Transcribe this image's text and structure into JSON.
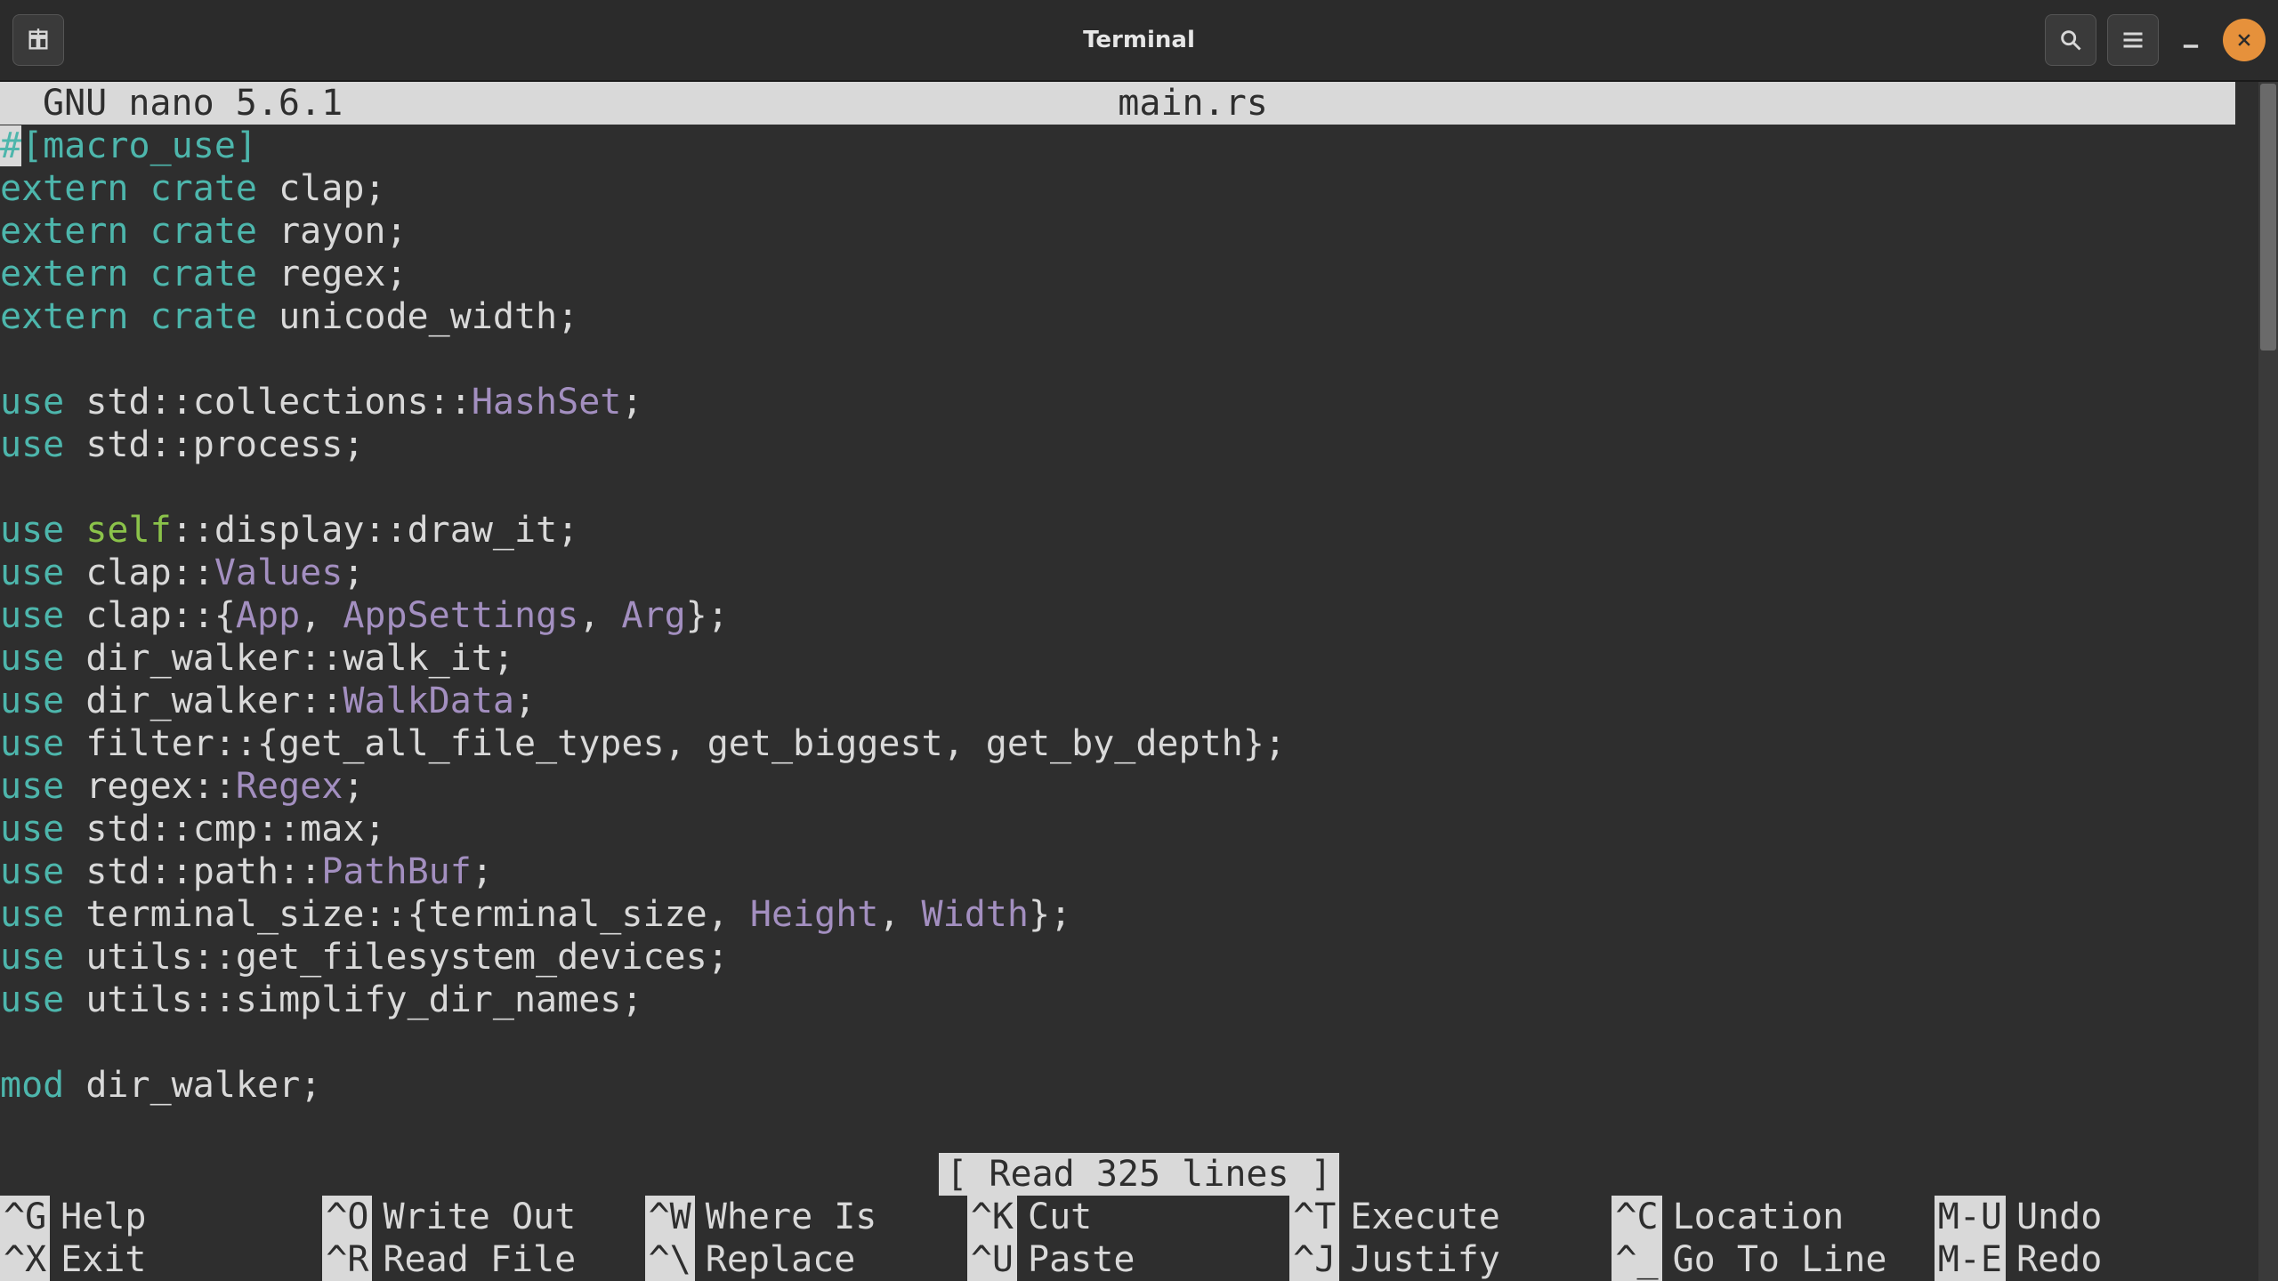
{
  "titlebar": {
    "title": "Terminal"
  },
  "nano": {
    "app_name": "GNU nano 5.6.1",
    "filename": "main.rs",
    "status": "[ Read 325 lines ]"
  },
  "code_lines": [
    {
      "tokens": [
        {
          "t": "#",
          "c": "c-hash"
        },
        {
          "t": "[macro_use]",
          "c": "c-attr"
        }
      ]
    },
    {
      "tokens": [
        {
          "t": "extern crate",
          "c": "c-kw"
        },
        {
          "t": " clap;",
          "c": "c-text"
        }
      ]
    },
    {
      "tokens": [
        {
          "t": "extern crate",
          "c": "c-kw"
        },
        {
          "t": " rayon;",
          "c": "c-text"
        }
      ]
    },
    {
      "tokens": [
        {
          "t": "extern crate",
          "c": "c-kw"
        },
        {
          "t": " regex;",
          "c": "c-text"
        }
      ]
    },
    {
      "tokens": [
        {
          "t": "extern crate",
          "c": "c-kw"
        },
        {
          "t": " unicode_width;",
          "c": "c-text"
        }
      ]
    },
    {
      "tokens": []
    },
    {
      "tokens": [
        {
          "t": "use",
          "c": "c-kw"
        },
        {
          "t": " std::collections::",
          "c": "c-text"
        },
        {
          "t": "HashSet",
          "c": "c-type"
        },
        {
          "t": ";",
          "c": "c-text"
        }
      ]
    },
    {
      "tokens": [
        {
          "t": "use",
          "c": "c-kw"
        },
        {
          "t": " std::process;",
          "c": "c-text"
        }
      ]
    },
    {
      "tokens": []
    },
    {
      "tokens": [
        {
          "t": "use",
          "c": "c-kw"
        },
        {
          "t": " ",
          "c": "c-text"
        },
        {
          "t": "self",
          "c": "c-self"
        },
        {
          "t": "::display::draw_it;",
          "c": "c-text"
        }
      ]
    },
    {
      "tokens": [
        {
          "t": "use",
          "c": "c-kw"
        },
        {
          "t": " clap::",
          "c": "c-text"
        },
        {
          "t": "Values",
          "c": "c-type"
        },
        {
          "t": ";",
          "c": "c-text"
        }
      ]
    },
    {
      "tokens": [
        {
          "t": "use",
          "c": "c-kw"
        },
        {
          "t": " clap::{",
          "c": "c-text"
        },
        {
          "t": "App",
          "c": "c-type"
        },
        {
          "t": ", ",
          "c": "c-text"
        },
        {
          "t": "AppSettings",
          "c": "c-type"
        },
        {
          "t": ", ",
          "c": "c-text"
        },
        {
          "t": "Arg",
          "c": "c-type"
        },
        {
          "t": "};",
          "c": "c-text"
        }
      ]
    },
    {
      "tokens": [
        {
          "t": "use",
          "c": "c-kw"
        },
        {
          "t": " dir_walker::walk_it;",
          "c": "c-text"
        }
      ]
    },
    {
      "tokens": [
        {
          "t": "use",
          "c": "c-kw"
        },
        {
          "t": " dir_walker::",
          "c": "c-text"
        },
        {
          "t": "WalkData",
          "c": "c-type"
        },
        {
          "t": ";",
          "c": "c-text"
        }
      ]
    },
    {
      "tokens": [
        {
          "t": "use",
          "c": "c-kw"
        },
        {
          "t": " filter::{get_all_file_types, get_biggest, get_by_depth};",
          "c": "c-text"
        }
      ]
    },
    {
      "tokens": [
        {
          "t": "use",
          "c": "c-kw"
        },
        {
          "t": " regex::",
          "c": "c-text"
        },
        {
          "t": "Regex",
          "c": "c-type"
        },
        {
          "t": ";",
          "c": "c-text"
        }
      ]
    },
    {
      "tokens": [
        {
          "t": "use",
          "c": "c-kw"
        },
        {
          "t": " std::cmp::max;",
          "c": "c-text"
        }
      ]
    },
    {
      "tokens": [
        {
          "t": "use",
          "c": "c-kw"
        },
        {
          "t": " std::path::",
          "c": "c-text"
        },
        {
          "t": "PathBuf",
          "c": "c-type"
        },
        {
          "t": ";",
          "c": "c-text"
        }
      ]
    },
    {
      "tokens": [
        {
          "t": "use",
          "c": "c-kw"
        },
        {
          "t": " terminal_size::{terminal_size, ",
          "c": "c-text"
        },
        {
          "t": "Height",
          "c": "c-type"
        },
        {
          "t": ", ",
          "c": "c-text"
        },
        {
          "t": "Width",
          "c": "c-type"
        },
        {
          "t": "};",
          "c": "c-text"
        }
      ]
    },
    {
      "tokens": [
        {
          "t": "use",
          "c": "c-kw"
        },
        {
          "t": " utils::get_filesystem_devices;",
          "c": "c-text"
        }
      ]
    },
    {
      "tokens": [
        {
          "t": "use",
          "c": "c-kw"
        },
        {
          "t": " utils::simplify_dir_names;",
          "c": "c-text"
        }
      ]
    },
    {
      "tokens": []
    },
    {
      "tokens": [
        {
          "t": "mod",
          "c": "c-kw"
        },
        {
          "t": " dir_walker;",
          "c": "c-text"
        }
      ]
    }
  ],
  "shortcuts_row1": [
    {
      "key": "^G",
      "label": "Help"
    },
    {
      "key": "^O",
      "label": "Write Out"
    },
    {
      "key": "^W",
      "label": "Where Is"
    },
    {
      "key": "^K",
      "label": "Cut"
    },
    {
      "key": "^T",
      "label": "Execute"
    },
    {
      "key": "^C",
      "label": "Location"
    },
    {
      "key": "M-U",
      "label": "Undo"
    }
  ],
  "shortcuts_row2": [
    {
      "key": "^X",
      "label": "Exit"
    },
    {
      "key": "^R",
      "label": "Read File"
    },
    {
      "key": "^\\",
      "label": "Replace"
    },
    {
      "key": "^U",
      "label": "Paste"
    },
    {
      "key": "^J",
      "label": "Justify"
    },
    {
      "key": "^_",
      "label": "Go To Line"
    },
    {
      "key": "M-E",
      "label": "Redo"
    }
  ]
}
